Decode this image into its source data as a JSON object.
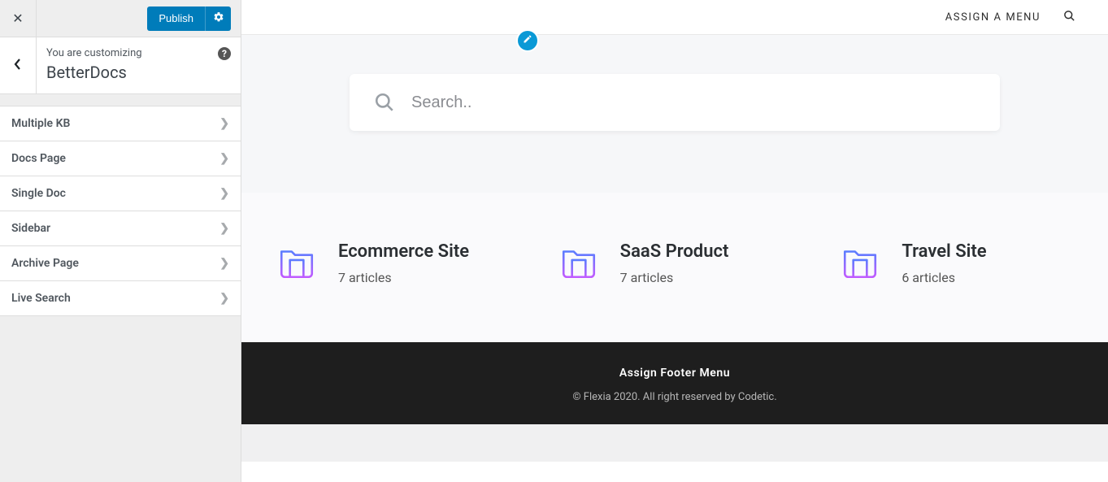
{
  "customizer": {
    "publish_label": "Publish",
    "subtitle": "You are customizing",
    "title": "BetterDocs",
    "help_glyph": "?",
    "menu": [
      {
        "label": "Multiple KB"
      },
      {
        "label": "Docs Page"
      },
      {
        "label": "Single Doc"
      },
      {
        "label": "Sidebar"
      },
      {
        "label": "Archive Page"
      },
      {
        "label": "Live Search"
      }
    ]
  },
  "preview": {
    "topbar": {
      "assign_menu_label": "ASSIGN A MENU"
    },
    "search": {
      "placeholder": "Search.."
    },
    "cards": [
      {
        "title": "Ecommerce Site",
        "subtitle": "7 articles"
      },
      {
        "title": "SaaS Product",
        "subtitle": "7 articles"
      },
      {
        "title": "Travel Site",
        "subtitle": "6 articles"
      }
    ],
    "footer": {
      "link_label": "Assign Footer Menu",
      "copyright": "© Flexia 2020. All right reserved by Codetic."
    }
  }
}
